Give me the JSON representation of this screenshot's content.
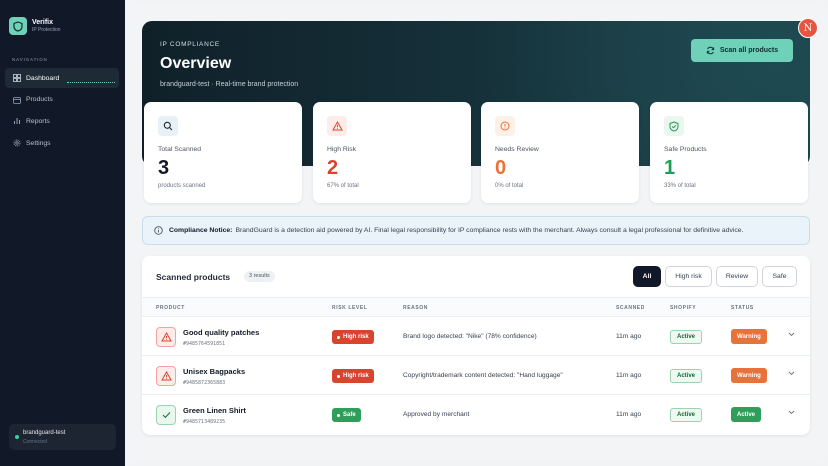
{
  "app": {
    "name": "Verifix",
    "subtitle": "IP Protection"
  },
  "sidebar": {
    "heading": "NAVIGATION",
    "items": [
      {
        "label": "Dashboard",
        "icon": "grid-icon",
        "active": true
      },
      {
        "label": "Products",
        "icon": "box-icon",
        "active": false
      },
      {
        "label": "Reports",
        "icon": "bar-chart-icon",
        "active": false
      },
      {
        "label": "Settings",
        "icon": "gear-icon",
        "active": false
      }
    ],
    "store": {
      "name": "brandguard-test",
      "status": "Connected"
    }
  },
  "hero": {
    "kicker": "IP COMPLIANCE",
    "title": "Overview",
    "subtitle": "brandguard-test · Real-time brand protection",
    "scan_button": "Scan all products",
    "avatar_initial": "N"
  },
  "stats": [
    {
      "label": "Total Scanned",
      "value": "3",
      "sub": "products scanned",
      "color": "#111827",
      "icon": "search-icon",
      "icon_bg": "#e8f1f8"
    },
    {
      "label": "High Risk",
      "value": "2",
      "sub": "67% of total",
      "color": "#d9442f",
      "icon": "warning-icon",
      "icon_bg": "#fdecea"
    },
    {
      "label": "Needs Review",
      "value": "0",
      "sub": "0% of total",
      "color": "#e8733a",
      "icon": "info-circle-icon",
      "icon_bg": "#fdf0e6"
    },
    {
      "label": "Safe Products",
      "value": "1",
      "sub": "33% of total",
      "color": "#1f9d55",
      "icon": "shield-check-icon",
      "icon_bg": "#e9f7ef"
    }
  ],
  "notice": {
    "title": "Compliance Notice:",
    "text": "BrandGuard is a detection aid powered by AI. Final legal responsibility for IP compliance rests with the merchant. Always consult a legal professional for definitive advice."
  },
  "products": {
    "title": "Scanned products",
    "count": "3 results",
    "filters": [
      "All",
      "High risk",
      "Review",
      "Safe"
    ],
    "active_filter": "All",
    "columns": [
      "PRODUCT",
      "RISK LEVEL",
      "REASON",
      "SCANNED",
      "SHOPIFY",
      "STATUS"
    ],
    "rows": [
      {
        "name": "Good quality patches",
        "id": "#9485764591851",
        "risk": "High risk",
        "reason": "Brand logo detected: \"Nike\" (78% confidence)",
        "scanned": "11m ago",
        "shopify": "Active",
        "status": "Warning",
        "kind": "risk"
      },
      {
        "name": "Unisex Bagpacks",
        "id": "#9485872365883",
        "risk": "High risk",
        "reason": "Copyright/trademark content detected: \"Hand luggage\"",
        "scanned": "11m ago",
        "shopify": "Active",
        "status": "Warning",
        "kind": "risk"
      },
      {
        "name": "Green Linen Shirt",
        "id": "#9485713489235",
        "risk": "Safe",
        "reason": "Approved by merchant",
        "scanned": "11m ago",
        "shopify": "Active",
        "status": "Active",
        "kind": "safe"
      }
    ]
  },
  "colors": {
    "accent": "#6fd1b8",
    "danger": "#d9442f",
    "warning": "#e8733a",
    "success": "#2f9e5b",
    "sidebar_bg": "#111827"
  }
}
